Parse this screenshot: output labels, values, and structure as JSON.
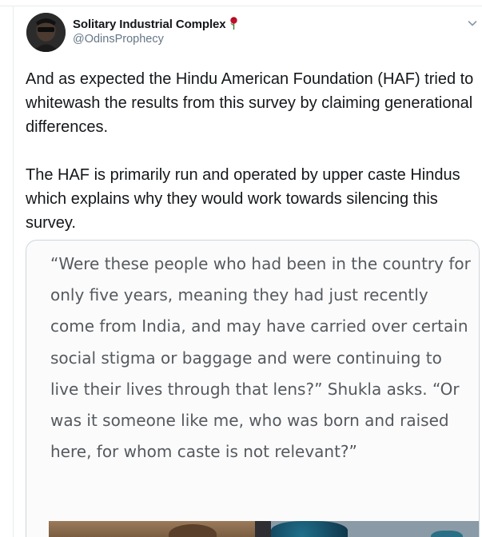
{
  "tweet": {
    "author": {
      "display_name": "Solitary Industrial Complex",
      "handle": "@OdinsProphecy",
      "name_emoji": "rose-icon"
    },
    "paragraphs": [
      "And as expected the Hindu American Foundation (HAF) tried to whitewash the results from this survey by claiming generational differences.",
      "The HAF is primarily run and operated by upper caste Hindus which explains why they would work towards silencing this survey."
    ],
    "menu_icon": "chevron-down-icon"
  },
  "media": {
    "quote_text": "“Were these people who had been in the country for only five years, meaning they had just recently come from India, and may have carried over certain social stigma or baggage and were continuing to live their lives through that lens?” Shukla asks. “Or was it someone like me, who was born and raised here, for whom caste is not relevant?”"
  },
  "colors": {
    "text_primary": "#14171a",
    "text_secondary": "#657786",
    "border": "#ccd6dd",
    "rose": "#c0102a"
  }
}
